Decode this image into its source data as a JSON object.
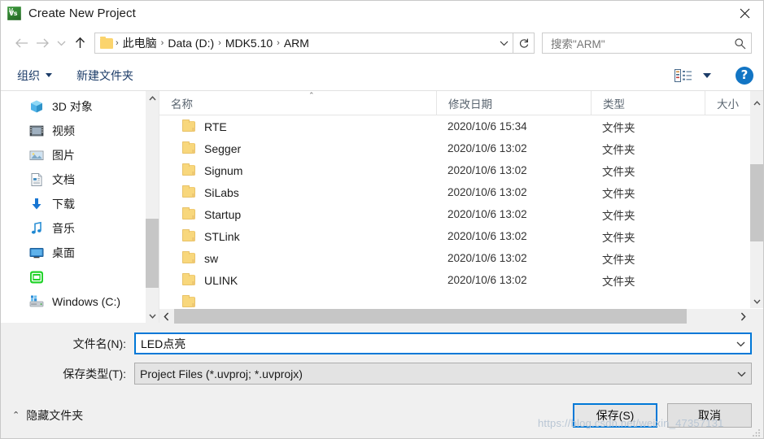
{
  "window": {
    "title": "Create New Project",
    "app_icon": "keil-uvision-icon",
    "close_label": "✕"
  },
  "navigation": {
    "back_icon": "arrow-left-icon",
    "forward_icon": "arrow-right-icon",
    "recent_icon": "chevron-down-icon",
    "up_icon": "arrow-up-icon",
    "folder_icon": "folder-icon",
    "breadcrumbs": [
      "此电脑",
      "Data (D:)",
      "MDK5.10",
      "ARM"
    ],
    "separator": "›",
    "dropdown_icon": "chevron-down-icon",
    "refresh_icon": "refresh-icon"
  },
  "search": {
    "placeholder": "搜索\"ARM\"",
    "icon": "search-icon"
  },
  "toolbar": {
    "organize_label": "组织",
    "new_folder_label": "新建文件夹",
    "view_icon": "list-view-icon",
    "view_dropdown_icon": "chevron-down-icon",
    "help_label": "?",
    "help_icon": "help-icon"
  },
  "sidebar": {
    "items": [
      {
        "label": "3D 对象",
        "icon": "3d-objects-icon"
      },
      {
        "label": "视频",
        "icon": "videos-icon"
      },
      {
        "label": "图片",
        "icon": "pictures-icon"
      },
      {
        "label": "文档",
        "icon": "documents-icon"
      },
      {
        "label": "下载",
        "icon": "downloads-icon"
      },
      {
        "label": "音乐",
        "icon": "music-icon"
      },
      {
        "label": "桌面",
        "icon": "desktop-icon"
      },
      {
        "label": "",
        "icon": "green-drive-icon"
      },
      {
        "label": "Windows (C:)",
        "icon": "local-disk-icon"
      }
    ],
    "scroll_up_icon": "chevron-up-icon",
    "scroll_down_icon": "chevron-down-icon"
  },
  "filelist": {
    "columns": [
      "名称",
      "修改日期",
      "类型",
      "大小"
    ],
    "sort_indicator": "ascending",
    "sort_caret": "⌃",
    "rows": [
      {
        "name": "RTE",
        "date": "2020/10/6 15:34",
        "type": "文件夹",
        "size": ""
      },
      {
        "name": "Segger",
        "date": "2020/10/6 13:02",
        "type": "文件夹",
        "size": ""
      },
      {
        "name": "Signum",
        "date": "2020/10/6 13:02",
        "type": "文件夹",
        "size": ""
      },
      {
        "name": "SiLabs",
        "date": "2020/10/6 13:02",
        "type": "文件夹",
        "size": ""
      },
      {
        "name": "Startup",
        "date": "2020/10/6 13:02",
        "type": "文件夹",
        "size": ""
      },
      {
        "name": "STLink",
        "date": "2020/10/6 13:02",
        "type": "文件夹",
        "size": ""
      },
      {
        "name": "sw",
        "date": "2020/10/6 13:02",
        "type": "文件夹",
        "size": ""
      },
      {
        "name": "ULINK",
        "date": "2020/10/6 13:02",
        "type": "文件夹",
        "size": ""
      }
    ],
    "hscroll_left_icon": "chevron-left-icon",
    "hscroll_right_icon": "chevron-right-icon",
    "vscroll_up_icon": "chevron-up-icon",
    "vscroll_down_icon": "chevron-down-icon"
  },
  "form": {
    "filename_label": "文件名(N):",
    "filename_value": "LED点亮",
    "filetype_label": "保存类型(T):",
    "filetype_value": "Project Files (*.uvproj; *.uvprojx)",
    "dropdown_icon": "chevron-down-icon"
  },
  "footer": {
    "hide_folders_label": "隐藏文件夹",
    "hide_folders_icon": "chevron-up-icon",
    "save_label": "保存(S)",
    "cancel_label": "取消",
    "resize_grip_icon": "resize-grip-icon"
  },
  "watermark": {
    "text": "https://blog.csdn.net/weixin_47357131"
  },
  "colors": {
    "accent": "#0078d7",
    "folder": "#f8d77c",
    "toolbar_link": "#1c3c68",
    "help_blue": "#1275c4",
    "panel": "#f0f0f0"
  }
}
